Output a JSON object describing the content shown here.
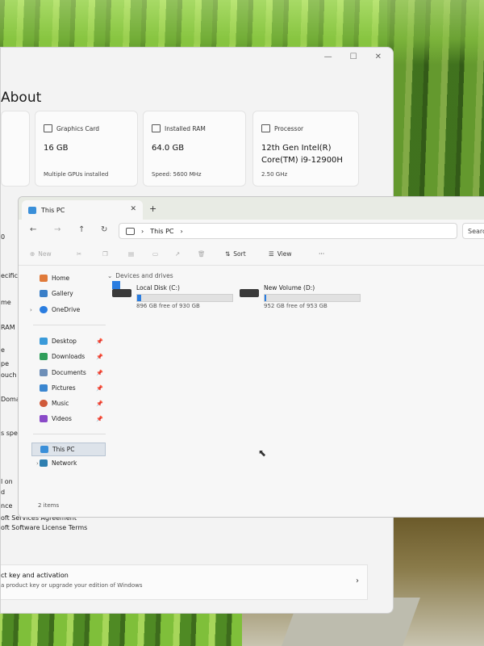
{
  "settings": {
    "title": "About",
    "window_controls": [
      "—",
      "☐",
      "✕"
    ],
    "cards": [
      {
        "label": "Graphics Card",
        "value": "16 GB",
        "sub": "Multiple GPUs installed"
      },
      {
        "label": "Installed RAM",
        "value": "64.0 GB",
        "sub": "Speed: 5600 MHz"
      },
      {
        "label": "Processor",
        "value": "12th Gen Intel(R) Core(TM) i9-12900H",
        "sub": "2.50 GHz"
      }
    ],
    "left_fragments": [
      "0",
      "ecificatio",
      "me",
      "RAM",
      "e",
      "pe",
      "ouch",
      "Domain",
      "s specifica",
      "l on",
      "d",
      "nce"
    ],
    "license_links": [
      "oft Services Agreement",
      "oft Software License Terms"
    ],
    "activation": {
      "title": "ct key and activation",
      "subtitle": "a product key or upgrade your edition of Windows",
      "chevron": "›"
    }
  },
  "explorer": {
    "tab_title": "This PC",
    "tab_close": "✕",
    "new_tab": "+",
    "nav": {
      "back": "←",
      "forward": "→",
      "up": "↑",
      "refresh": "↻"
    },
    "address": {
      "location": "This PC",
      "separator": "›"
    },
    "search_placeholder": "Searc",
    "command_bar": {
      "new": "New",
      "sort": "Sort",
      "view": "View",
      "more": "···"
    },
    "sidebar": [
      {
        "label": "Home",
        "icon": "home-icon"
      },
      {
        "label": "Gallery",
        "icon": "gallery-icon"
      },
      {
        "label": "OneDrive",
        "icon": "onedrive-icon"
      },
      {
        "label": "Desktop",
        "icon": "desktop-folder-icon"
      },
      {
        "label": "Downloads",
        "icon": "downloads-icon"
      },
      {
        "label": "Documents",
        "icon": "documents-icon"
      },
      {
        "label": "Pictures",
        "icon": "pictures-icon"
      },
      {
        "label": "Music",
        "icon": "music-icon"
      },
      {
        "label": "Videos",
        "icon": "videos-icon"
      },
      {
        "label": "This PC",
        "icon": "this-pc-icon"
      },
      {
        "label": "Network",
        "icon": "network-icon"
      }
    ],
    "group_header": "Devices and drives",
    "drives": [
      {
        "name": "Local Disk (C:)",
        "free": "896 GB free of 930 GB",
        "used_fraction": 0.04
      },
      {
        "name": "New Volume (D:)",
        "free": "952 GB free of 953 GB",
        "used_fraction": 0.001
      }
    ],
    "status": "2 items",
    "colors": {
      "accent": "#2a7de0",
      "selection": "#dde3ea"
    }
  }
}
